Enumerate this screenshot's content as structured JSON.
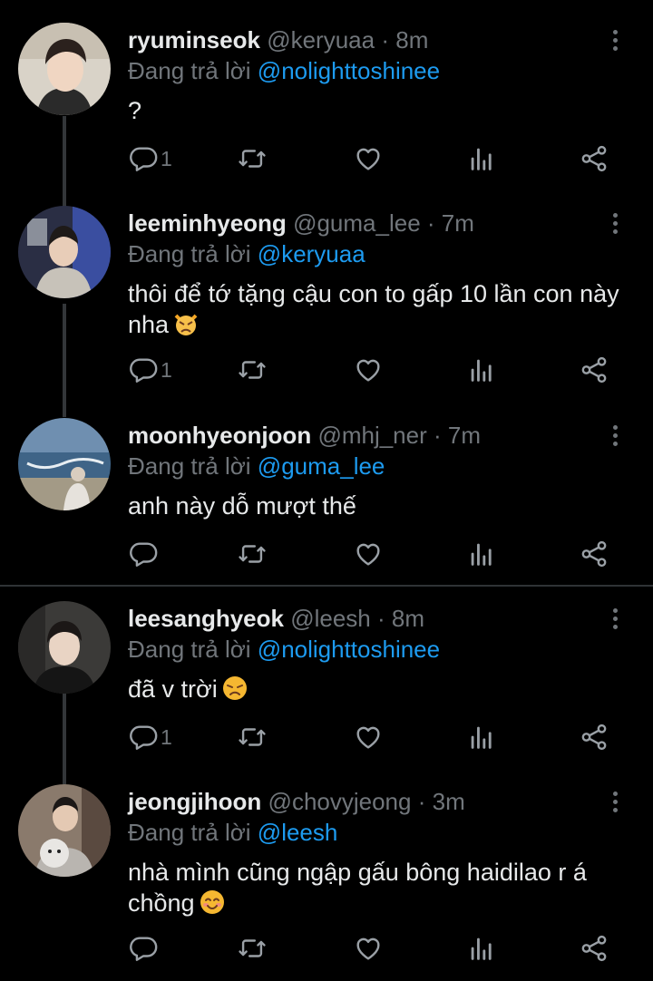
{
  "tweets": [
    {
      "name": "ryuminseok",
      "handle": "@keryuaa",
      "dot": "·",
      "time": "8m",
      "reply_prefix": "Đang trả lời",
      "reply_to": "@nolighttoshinee",
      "text": "?",
      "emoji": "",
      "reply_count": "1"
    },
    {
      "name": "leeminhyeong",
      "handle": "@guma_lee",
      "dot": "·",
      "time": "7m",
      "reply_prefix": "Đang trả lời",
      "reply_to": "@keryuaa",
      "text": "thôi để tớ tặng cậu con to gấp 10 lần con này nha",
      "emoji": "pouting-cat-emoji",
      "reply_count": "1"
    },
    {
      "name": "moonhyeonjoon",
      "handle": "@mhj_ner",
      "dot": "·",
      "time": "7m",
      "reply_prefix": "Đang trả lời",
      "reply_to": "@guma_lee",
      "text": "anh này dỗ mượt thế",
      "emoji": "",
      "reply_count": ""
    },
    {
      "name": "leesanghyeok",
      "handle": "@leesh",
      "dot": "·",
      "time": "8m",
      "reply_prefix": "Đang trả lời",
      "reply_to": "@nolighttoshinee",
      "text": "đã v trời",
      "emoji": "disappointed-face-emoji",
      "reply_count": "1"
    },
    {
      "name": "jeongjihoon",
      "handle": "@chovyjeong",
      "dot": "·",
      "time": "3m",
      "reply_prefix": "Đang trả lời",
      "reply_to": "@leesh",
      "text": "nhà mình cũng ngập gấu bông haidilao r á chồng",
      "emoji": "smiling-face-emoji",
      "reply_count": ""
    }
  ],
  "colors": {
    "background": "#000000",
    "accent": "#1d9bf0",
    "muted": "#71767b",
    "text": "#e7e9ea"
  },
  "icons": [
    "reply-icon",
    "retweet-icon",
    "like-icon",
    "views-icon",
    "share-icon",
    "more-icon"
  ]
}
